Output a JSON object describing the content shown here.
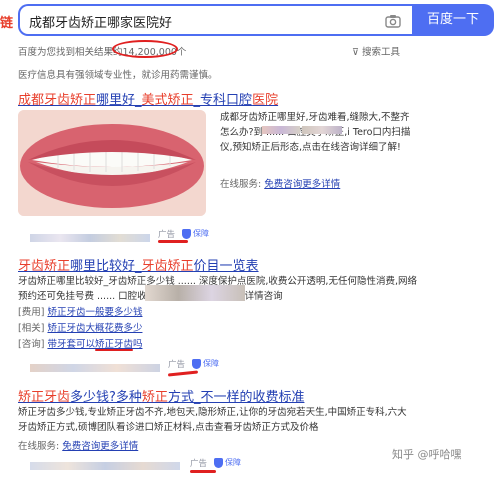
{
  "search": {
    "query": "成都牙齿矫正哪家医院好",
    "button_label": "百度一下",
    "edge_char": "链"
  },
  "result_stats": {
    "prefix": "百度为您找到相关结果约",
    "count": "14,200,000个",
    "tools_label": "搜索工具"
  },
  "notice": "医疗信息具有强领域专业性，就诊用药需谨慎。",
  "ad1": {
    "title_parts": [
      "成都牙齿矫正",
      "哪里好_",
      "美式矫正",
      "_专科口腔",
      "医院"
    ],
    "desc": "成都牙齿矫正哪里好,牙齿难看,缝隙大,不整齐怎么办?到 ...... 口腔美学矫正,i Tero口内扫描仪,预知矫正后形态,点击在线咨询详细了解!",
    "service_label": "在线服务:",
    "service_link": "免费咨询更多详情",
    "ad_tag": "广告",
    "guarantee": "保障"
  },
  "ad2": {
    "title_parts": [
      "牙齿矫正",
      "哪里比较好_",
      "牙齿矫正",
      "价目一览表"
    ],
    "desc": "牙齿矫正哪里比较好_牙齿矫正多少钱 ...... 深度保护点医院,收费公开透明,无任何隐性消费,网络预约还可免挂号费 ...... 口腔收费价目一览表,点击查看详情咨询",
    "sublinks": [
      {
        "tag": "[费用]",
        "text": "矫正牙齿一般要多少钱"
      },
      {
        "tag": "[相关]",
        "text": "矫正牙齿大概花费多少"
      },
      {
        "tag": "[咨询]",
        "text": "带牙套可以矫正牙齿吗"
      }
    ],
    "ad_tag": "广告",
    "guarantee": "保障"
  },
  "ad3": {
    "title_parts": [
      "矫正牙齿",
      "多少钱?多种",
      "矫正",
      "方式_不一样的收费标准"
    ],
    "desc": "矫正牙齿多少钱,专业矫正牙齿不齐,地包天,隐形矫正,让你的牙齿宛若天生,中国矫正专科,六大牙齿矫正方式,硕博团队看诊进口矫正材料,点击查看牙齿矫正方式及价格",
    "service_label": "在线服务:",
    "service_link": "免费咨询更多详情",
    "ad_tag": "广告",
    "guarantee": "保障"
  },
  "watermark": "知乎 @呼哈嘿",
  "colors": {
    "accent_blue": "#4e6ef2",
    "link_blue": "#2440b3",
    "keyword_red": "#e83f2c",
    "annotation_red": "#e02020"
  }
}
